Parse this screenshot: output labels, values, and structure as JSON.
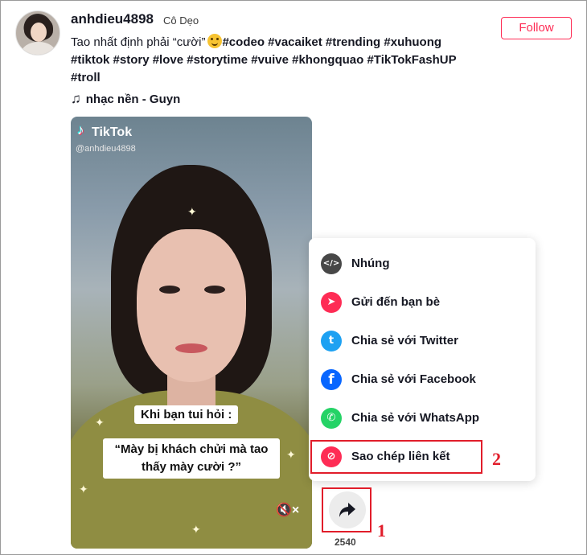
{
  "post": {
    "username": "anhdieu4898",
    "nickname": "Cô Dẹo ",
    "follow_label": "Follow",
    "caption_text": "Tao nhất định phải “cười”",
    "hashtags_line1": "#codeo #vacaiket #trending #xuhuong",
    "hashtags_line2": "#tiktok #story #love #storytime #vuive #khongquao #TikTokFashUP",
    "hashtags_line3": "#troll",
    "music_icon": "♫",
    "music": "nhạc nền - Guyn"
  },
  "video": {
    "logo": "TikTok",
    "handle": "@anhdieu4898",
    "subtitle1": "Khi bạn tui hỏi :",
    "subtitle2": "“Mày bị khách chửi mà tao thấy mày cười ?”",
    "mute_icon": "🔇×"
  },
  "share_menu": {
    "items": [
      {
        "label": "Nhúng",
        "icon": "embed-icon",
        "color": "#474747",
        "glyph": "</>"
      },
      {
        "label": "Gửi đến bạn bè",
        "icon": "send-icon",
        "color": "#fe2c55",
        "glyph": "➤"
      },
      {
        "label": "Chia sẻ với Twitter",
        "icon": "twitter-icon",
        "color": "#1da1f2",
        "glyph": "t"
      },
      {
        "label": "Chia sẻ với Facebook",
        "icon": "facebook-icon",
        "color": "#0866ff",
        "glyph": "f"
      },
      {
        "label": "Chia sẻ với WhatsApp",
        "icon": "whatsapp-icon",
        "color": "#25d366",
        "glyph": "✆"
      },
      {
        "label": "Sao chép liên kết",
        "icon": "link-icon",
        "color": "#fe2c55",
        "glyph": "⊘"
      }
    ]
  },
  "share": {
    "count": "2540"
  },
  "annotations": {
    "step1": "1",
    "step2": "2",
    "color": "#e11d2a"
  }
}
